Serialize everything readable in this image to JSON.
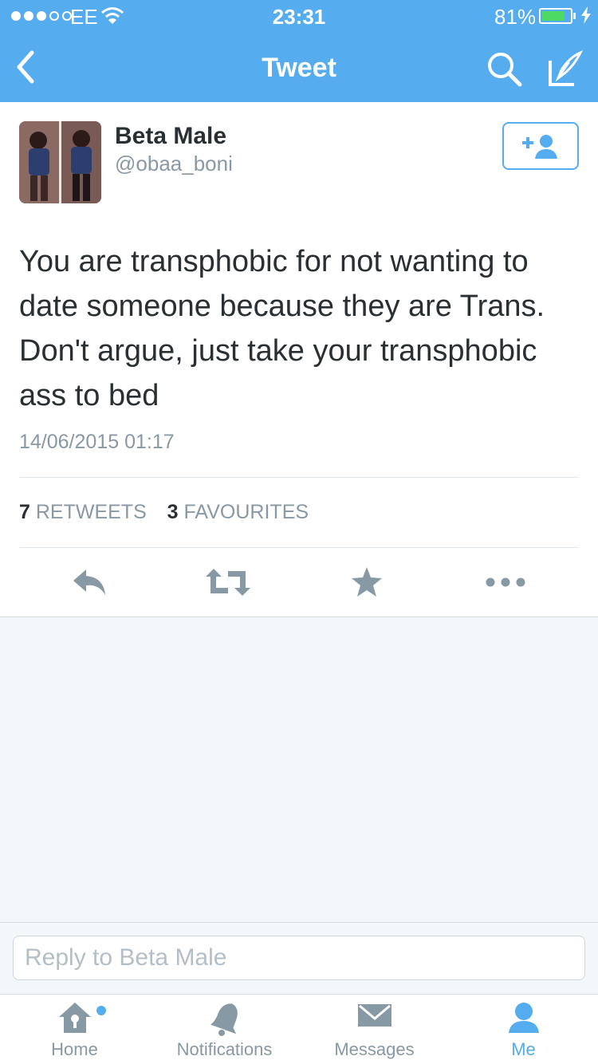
{
  "status_bar": {
    "carrier": "EE",
    "time": "23:31",
    "battery": "81%",
    "battery_level": 0.81
  },
  "nav": {
    "title": "Tweet"
  },
  "tweet": {
    "display_name": "Beta Male",
    "handle": "@obaa_boni",
    "text": "You are transphobic for not wanting to date someone because they are Trans. Don't argue, just take your transphobic ass to bed",
    "timestamp": "14/06/2015 01:17",
    "retweets_count": "7",
    "retweets_label": "RETWEETS",
    "favourites_count": "3",
    "favourites_label": "FAVOURITES"
  },
  "reply": {
    "placeholder": "Reply to Beta Male"
  },
  "tabs": [
    {
      "label": "Home",
      "icon": "home-icon"
    },
    {
      "label": "Notifications",
      "icon": "bell-icon"
    },
    {
      "label": "Messages",
      "icon": "envelope-icon"
    },
    {
      "label": "Me",
      "icon": "person-icon"
    }
  ],
  "colors": {
    "brand": "#55acee",
    "icon_gray": "#8899a6",
    "text": "#292f33",
    "battery": "#4cd964"
  }
}
